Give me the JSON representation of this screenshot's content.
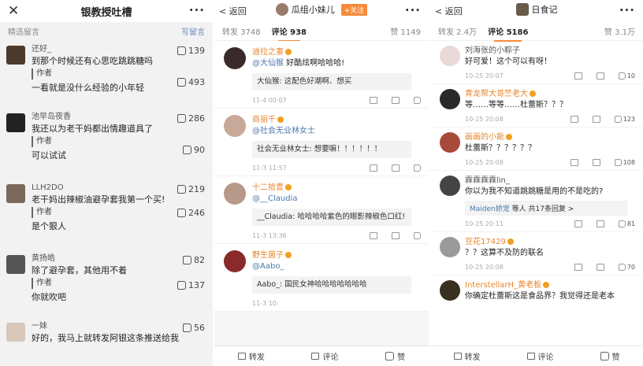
{
  "panel1": {
    "title": "银教授吐槽",
    "section_label": "精选留言",
    "write_label": "写留言",
    "comments": [
      {
        "name": "还好_",
        "text": "到那个时候还有心思吃跳跳糖吗",
        "likes": "139",
        "author_label": "作者",
        "reply": "一看就是没什么经验的小年轻",
        "reply_likes": "493"
      },
      {
        "name": "池早岛夜香",
        "text": "我还以为老干妈都出情趣道具了",
        "likes": "286",
        "author_label": "作者",
        "reply": "可以试试",
        "reply_likes": "90"
      },
      {
        "name": "LLH2DO",
        "text": "老干妈出辣椒油避孕套我第一个买!",
        "likes": "219",
        "author_label": "作者",
        "reply": "是个狠人",
        "reply_likes": "246"
      },
      {
        "name": "黄扬皓",
        "text": "除了避孕套，其他用不着",
        "likes": "82",
        "author_label": "作者",
        "reply": "你就吹吧",
        "reply_likes": "137"
      },
      {
        "name": "一妹",
        "text": "好的，我马上就转发阿银这条推送给我",
        "likes": "56"
      }
    ]
  },
  "panel2": {
    "back": "返回",
    "account": "瓜组小妹儿",
    "follow": "+关注",
    "repost": "转发 3748",
    "comments_tab": "评论 938",
    "likes": "赞 1149",
    "comments": [
      {
        "name": "迪拉之妻",
        "at": "@大仙猴",
        "text": " 好酷炫啊哈哈哈!",
        "reply": "大仙猴: 这配色好潮啊、想买",
        "time": "11-4 00:07"
      },
      {
        "name": "商丽千",
        "at": "@社会无业林女士",
        "text": "",
        "reply": "社会无业林女士: 想要嘛！！！！！！",
        "time": "11-3 11:57"
      },
      {
        "name": "十二拾壹",
        "at": "@__Claudia",
        "text": "",
        "reply": "__Claudia: 哈哈哈哈紫色的眼影辣椒色口红!",
        "time": "11-3 13:36"
      },
      {
        "name": "野生菌子",
        "at": "@Aabo_",
        "text": "",
        "reply": "Aabo_: 国民女神哈哈哈哈哈哈哈",
        "time": "11-3 10:"
      }
    ],
    "bottom": {
      "repost": "转发",
      "comment": "评论",
      "like": "赞"
    }
  },
  "panel3": {
    "back": "返回",
    "account": "日食记",
    "repost": "转发 2.4万",
    "comments_tab": "评论 5186",
    "likes": "赞 3.1万",
    "comments": [
      {
        "name": "刘海张的小粽子",
        "text": "好可爱！这个可以有呀！",
        "time": "10-25 20:07",
        "likes": "10"
      },
      {
        "name": "青龙帮大哥竺老大",
        "text": "等……等等……杜蕾斯？？？",
        "time": "10-25 20:08",
        "likes": "123"
      },
      {
        "name": "画画的小能",
        "text": "杜蕾斯？？？？？？",
        "time": "10-25 20:08",
        "likes": "108"
      },
      {
        "name": "霖霖霖霖lin_",
        "text": "你以为我不知道跳跳糖是用的不是吃的?",
        "reply_user": "Maiden娇宠",
        "reply_text": "等人  共17条回复 >",
        "time": "10-25 20:11",
        "likes": "81"
      },
      {
        "name": "豆花17429",
        "text": "？？这算不及防的联名",
        "time": "10-25 20:08",
        "likes": "70"
      },
      {
        "name": "InterstellarH_黄老板",
        "text": "你确定杜蕾斯这是食品界？我觉得还是老本",
        "time": "",
        "likes": ""
      }
    ],
    "bottom": {
      "repost": "转发",
      "comment": "评论",
      "like": "赞"
    }
  }
}
